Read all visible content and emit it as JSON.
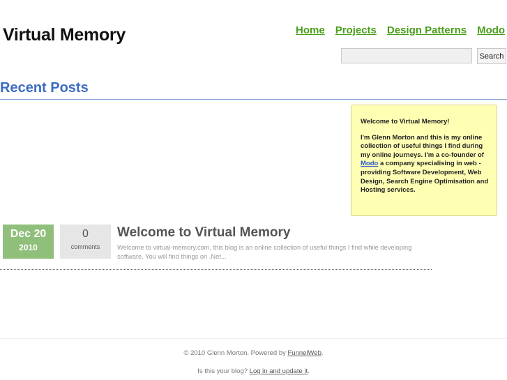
{
  "site": {
    "title": "Virtual Memory"
  },
  "nav": {
    "items": [
      "Home",
      "Projects",
      "Design Patterns",
      "Modo"
    ]
  },
  "search": {
    "button_label": "Search",
    "value": ""
  },
  "recent_posts": {
    "heading": "Recent Posts"
  },
  "welcome_box": {
    "title": "Welcome to Virtual Memory!",
    "body_before_link": "I'm Glenn Morton and this is my online collection of useful things I find during my online journeys. I'm a co-founder of ",
    "link_text": "Modo",
    "body_after_link": " a company specialising in web - providing Software Development, Web Design, Search Engine Optimisation and Hosting services."
  },
  "posts": [
    {
      "date_day": "Dec 20",
      "date_year": "2010",
      "comment_count": "0",
      "comment_label": "comments",
      "title": "Welcome to Virtual Memory",
      "excerpt": "Welcome to virtual-memory.com, this blog is an online collection of useful things I find while developing software. You will find things on .Net..."
    }
  ],
  "footer": {
    "copyright_prefix": "© 2010 Glenn Morton. Powered by ",
    "powered_link": "FunnelWeb",
    "copyright_suffix": ".",
    "claim_prefix": "Is this your blog? ",
    "claim_link": "Log in and update it",
    "claim_suffix": "."
  },
  "colors": {
    "nav_link": "#4a9e1a",
    "section_heading": "#3c6cc4",
    "welcome_box_bg": "#ffffb4",
    "date_badge_bg": "#8fbf7a",
    "comment_badge_bg": "#e6e6e6"
  }
}
